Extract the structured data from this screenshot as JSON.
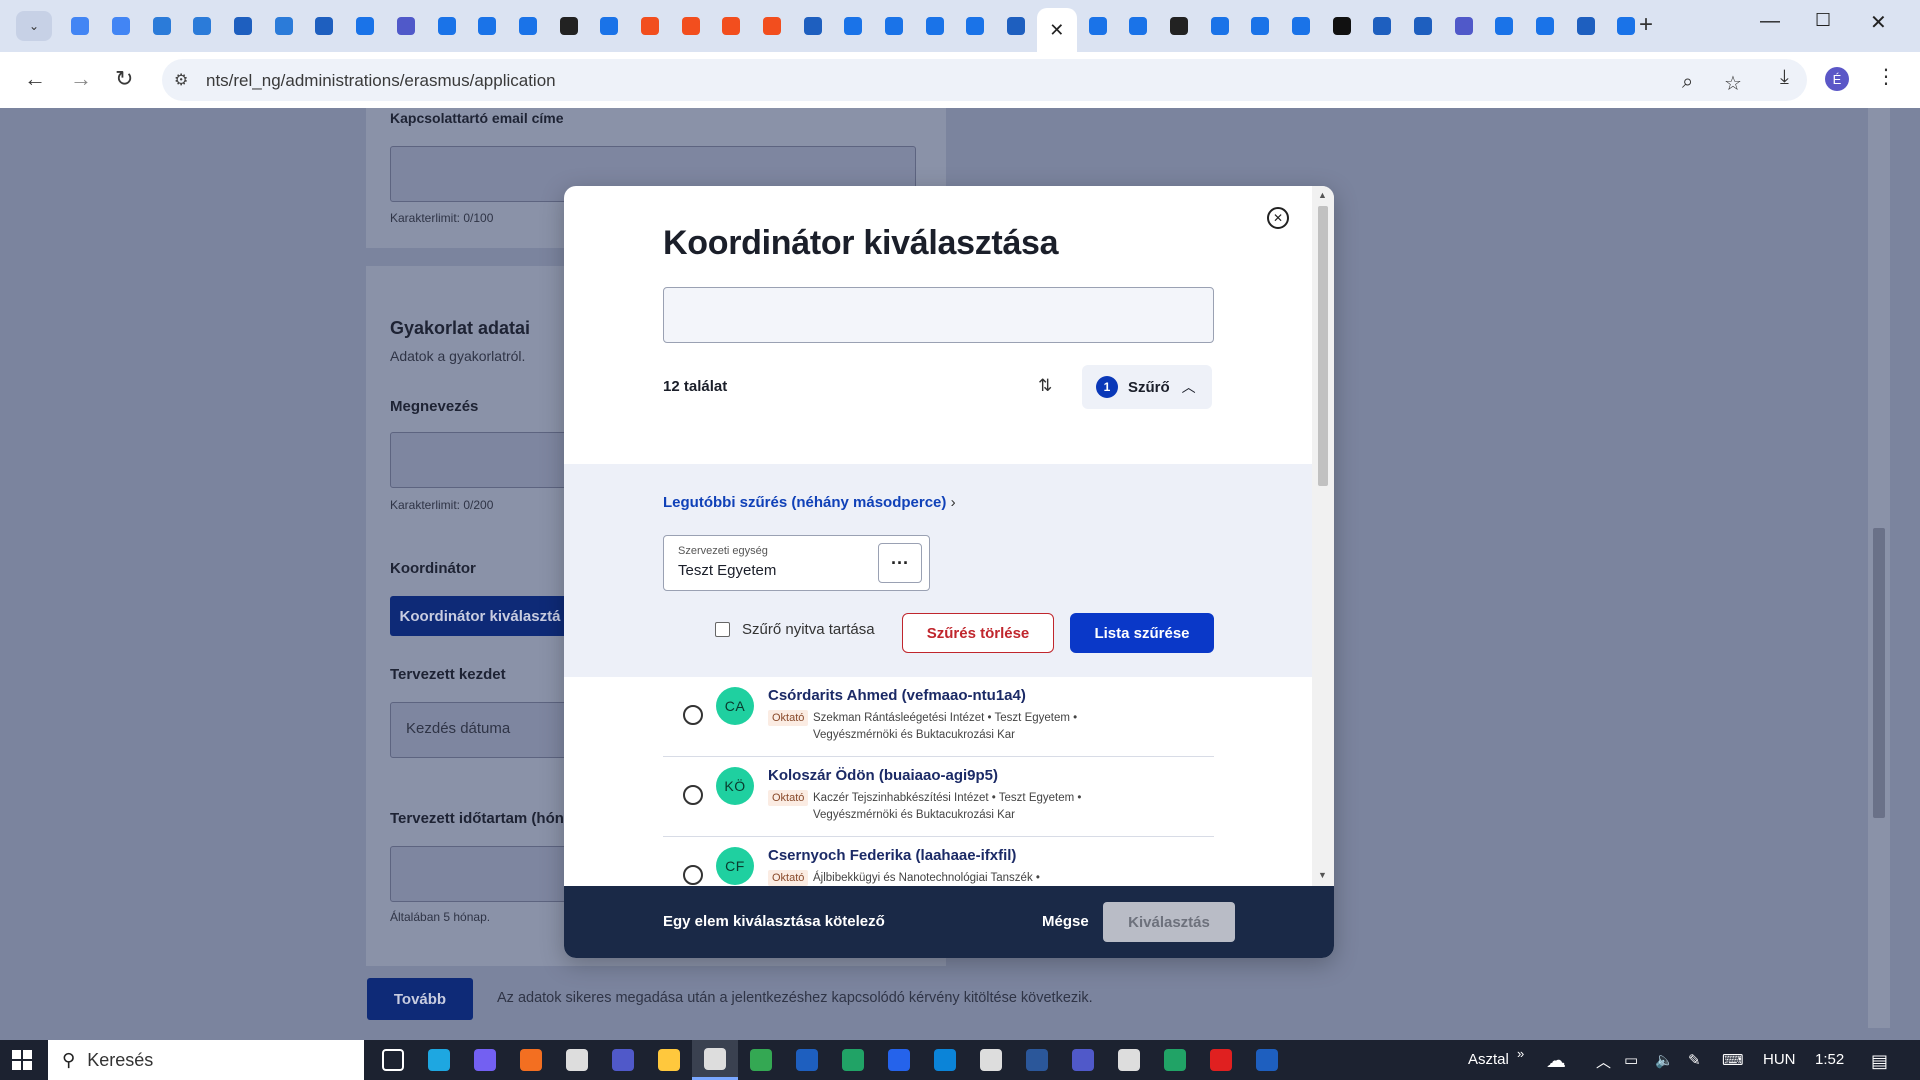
{
  "browser": {
    "url": "nts/rel_ng/administrations/erasmus/application",
    "profile_initial": "É",
    "tab_colors": [
      "#4285f4",
      "#4285f4",
      "#2b7bd9",
      "#2b7bd9",
      "#1e5fbf",
      "#2b7bd9",
      "#1e5fbf",
      "#1a73e8",
      "#5059c9",
      "#1a73e8",
      "#1a73e8",
      "#1a73e8",
      "#222",
      "#1a73e8",
      "#f24e1e",
      "#f24e1e",
      "#f24e1e",
      "#f24e1e",
      "#1e5fbf",
      "#1a73e8",
      "#1a73e8",
      "#1a73e8",
      "#1a73e8",
      "#1e5fbf",
      "#fff",
      "#1a73e8",
      "#1a73e8",
      "#222",
      "#1a73e8",
      "#1a73e8",
      "#1a73e8",
      "#111",
      "#1e5fbf",
      "#1e5fbf",
      "#5059c9",
      "#1a73e8",
      "#1a73e8",
      "#1e5fbf",
      "#1a73e8"
    ]
  },
  "page": {
    "contact_email_label": "Kapcsolattartó email címe",
    "contact_email_limit": "Karakterlimit: 0/100",
    "practice_title": "Gyakorlat adatai",
    "practice_subtitle": "Adatok a gyakorlatról.",
    "name_label": "Megnevezés",
    "name_limit": "Karakterlimit: 0/200",
    "coordinator_label": "Koordinátor",
    "coordinator_button": "Koordinátor kiválasztá",
    "planned_start_label": "Tervezett kezdet",
    "start_placeholder": "Kezdés dátuma",
    "planned_duration_label": "Tervezett időtartam (hónap",
    "duration_hint": "Általában 5 hónap.",
    "next_button": "Tovább",
    "next_hint": "Az adatok sikeres megadása után a jelentkezéshez kapcsolódó kérvény kitöltése következik."
  },
  "modal": {
    "title": "Koordinátor kiválasztása",
    "search_value": "",
    "result_count": "12 találat",
    "filter_badge": "1",
    "filter_label": "Szűrő",
    "recent_filter": "Legutóbbi szűrés (néhány másodperce)",
    "org_unit_label": "Szervezeti egység",
    "org_unit_value": "Teszt Egyetem",
    "keep_open_label": "Szűrő nyitva tartása",
    "clear_filter": "Szűrés törlése",
    "apply_filter": "Lista szűrése",
    "results": [
      {
        "initials": "CA",
        "name": "Csórdarits Ahmed (vefmaao-ntu1a4)",
        "role": "Oktató",
        "path": "Szekman Rántásleégetési Intézet • Teszt Egyetem • Vegyészmérnöki és Buktacukrozási Kar"
      },
      {
        "initials": "KÖ",
        "name": "Koloszár Ödön (buaiaao-agi9p5)",
        "role": "Oktató",
        "path": "Kaczér Tejszinhabkészítési Intézet • Teszt Egyetem • Vegyészmérnöki és Buktacukrozási Kar"
      },
      {
        "initials": "CF",
        "name": "Csernyoch Federika (laahaae-ifxfil)",
        "role": "Oktató",
        "path": "Ájlbibekkügyi és Nanotechnológiai Tanszék •"
      }
    ],
    "footer_message": "Egy elem kiválasztása kötelező",
    "cancel_label": "Mégse",
    "select_label": "Kiválasztás"
  },
  "taskbar": {
    "search_label": "Keresés",
    "desktop_label": "Asztal",
    "language": "HUN",
    "time": "1:52",
    "app_colors": [
      "#fff",
      "#1ea7e1",
      "#7360f2",
      "#f36f21",
      "#ddd",
      "#5059c9",
      "#ffc83d",
      "#ddd",
      "#34a853",
      "#1e5fbf",
      "#21a366",
      "#2563eb",
      "#0b84d8",
      "#ddd",
      "#2b579a",
      "#5059c9",
      "#ddd",
      "#21a366",
      "#e02020",
      "#1e5fbf"
    ]
  }
}
